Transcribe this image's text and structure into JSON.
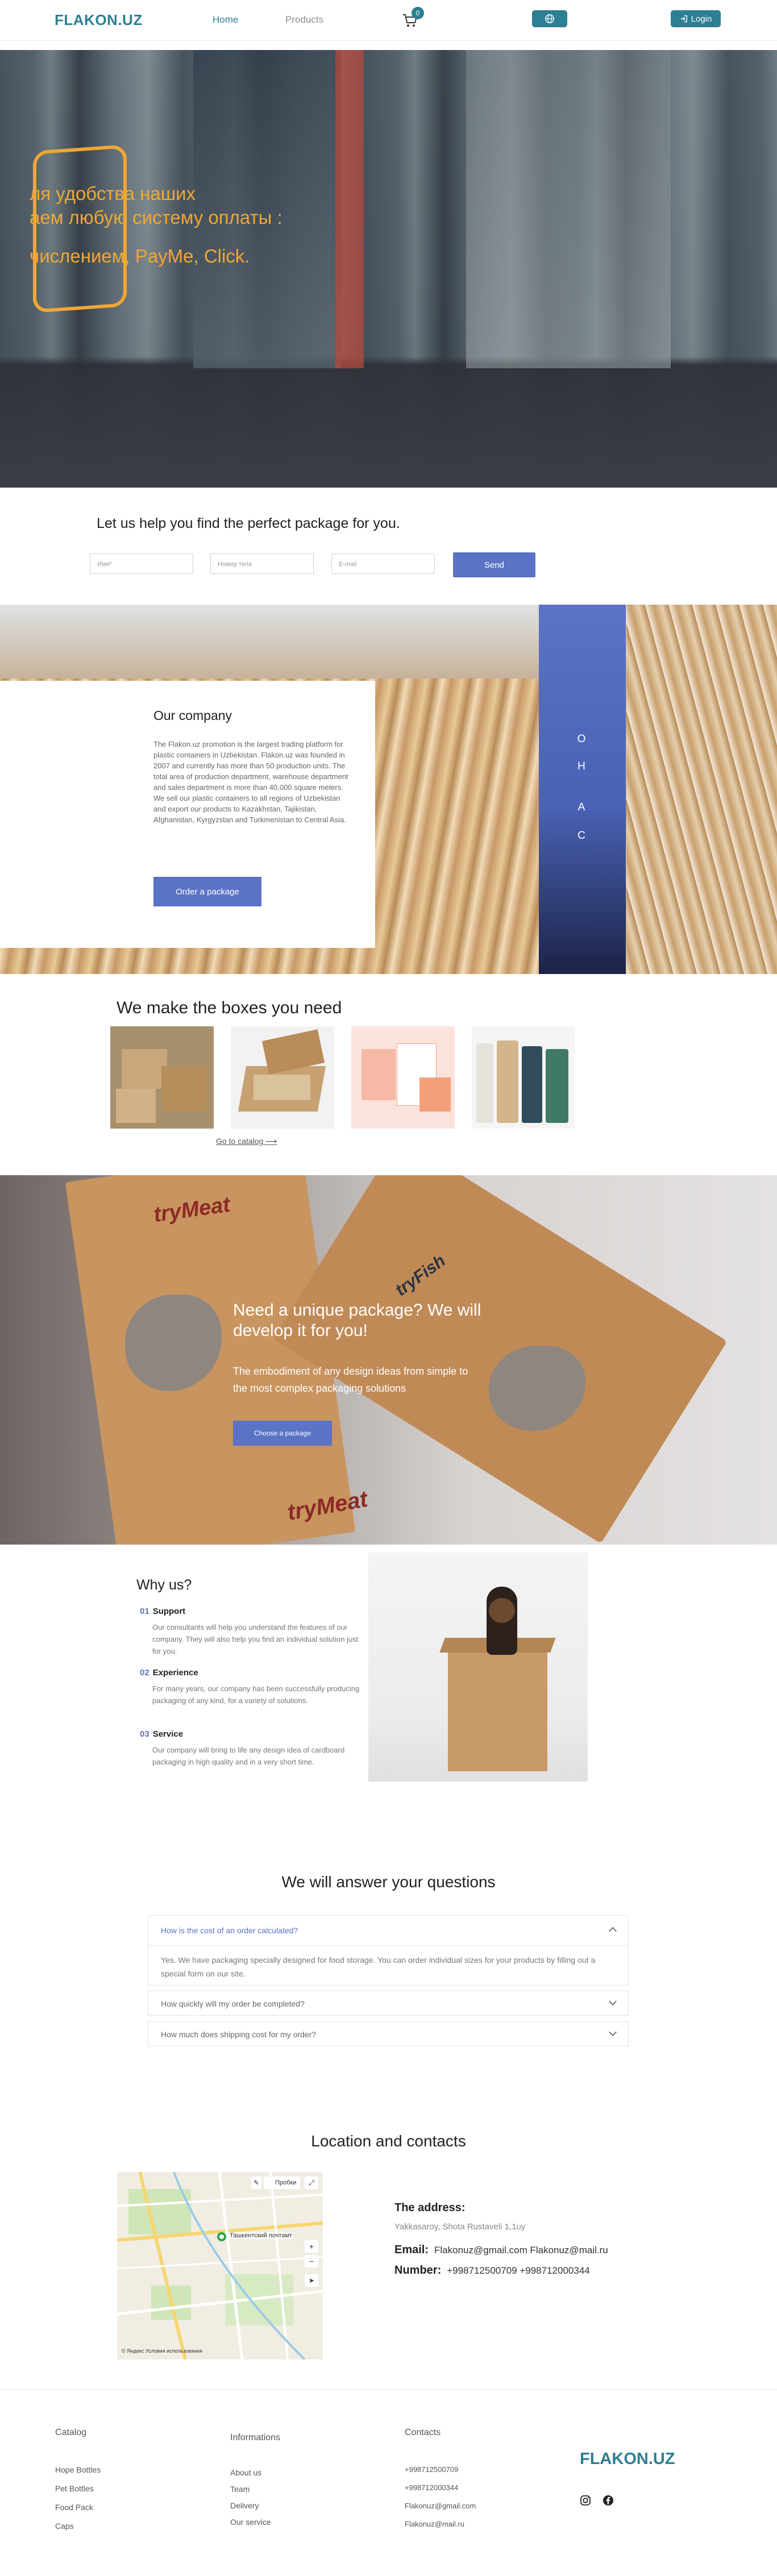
{
  "header": {
    "logo": "FLAKON.UZ",
    "nav": {
      "home": "Home",
      "products": "Products"
    },
    "cart_count": "0",
    "login_label": "Login"
  },
  "hero": {
    "line1": "ля удобства наших",
    "line2": "аем любую систему оплаты :",
    "line3": "числением, PayMe, Click."
  },
  "lead": {
    "title": "Let us help you find the perfect package for you.",
    "name_placeholder": "Имя*",
    "phone_placeholder": "Номер тела",
    "email_placeholder": "E-mail",
    "send_label": "Send"
  },
  "company": {
    "title": "Our company",
    "text": "The Flakon.uz promotion is the largest trading platform for plastic containers in Uzbekistan. Flakon.uz was founded in 2007 and currently has more than 50 production units. The total area of production department, warehouse department and sales department is more than 40,000 square meters. We sell our plastic containers to all regions of Uzbekistan and export our products to Kazakhstan, Tajikistan, Afghanistan, Kyrgyzstan and Turkmenistan to Central Asia.",
    "order_label": "Order a package",
    "about_letters": [
      "О",
      "Н",
      "А",
      "С"
    ]
  },
  "boxes": {
    "title": "We make the boxes you need",
    "catalog_link": "Go to catalog"
  },
  "unique": {
    "title": "Need a unique package? We will develop it for you!",
    "subtitle": "The embodiment of any design ideas from simple to the most complex packaging solutions",
    "button_label": "Choose a package",
    "brand1": "tryMeat",
    "brand2": "tryFish",
    "brand3": "tryMeat"
  },
  "why": {
    "title": "Why us?",
    "items": [
      {
        "num": "01",
        "head": "Support",
        "desc": "Our consultants will help you understand the features of our company. They will also help you find an individual solution just for you."
      },
      {
        "num": "02",
        "head": "Experience",
        "desc": "For many years, our company has been successfully producing packaging of any kind, for a variety of solutions."
      },
      {
        "num": "03",
        "head": "Service",
        "desc": "Our company will bring to life any design idea of cardboard packaging in high quality and in a very short time."
      }
    ]
  },
  "faq": {
    "title": "We will answer your questions",
    "items": [
      {
        "q": "How is the cost of an order calculated?",
        "a": "Yes. We have packaging specially designed for food storage. You can order individual sizes for your products by filling out a special form on our site."
      },
      {
        "q": "How quickly will my order be completed?"
      },
      {
        "q": "How much does shipping cost for my order?"
      }
    ]
  },
  "location": {
    "title": "Location and contacts",
    "map_probki": "Пробки",
    "map_place": "Ташкентский почтамт",
    "map_yandex": "© Яндекс",
    "map_terms": "Условия использования",
    "address_label": "The address:",
    "address_value": "Yakkasaroy, Shota Rustaveli 1,1uy",
    "email_label": "Email:",
    "email_values": "Flakonuz@gmail.com   Flakonuz@mail.ru",
    "number_label": "Number:",
    "number_values": "+998712500709   +998712000344"
  },
  "footer": {
    "catalog_head": "Catalog",
    "catalog_links": [
      "Hope Bottles",
      "Pet Bottles",
      "Food Pack",
      "Caps"
    ],
    "info_head": "Informations",
    "info_links": [
      "About us",
      "Team",
      "Delivery",
      "Our service"
    ],
    "contacts_head": "Contacts",
    "contacts_links": [
      "+998712500709",
      "+998712000344",
      "Flakonuz@gmail.com",
      "Flakonuz@mail.ru"
    ],
    "logo": "FLAKON.UZ"
  },
  "colors": {
    "brand": "#2d7f93",
    "accent": "#5b73c5",
    "hero_text": "#f0a734"
  }
}
